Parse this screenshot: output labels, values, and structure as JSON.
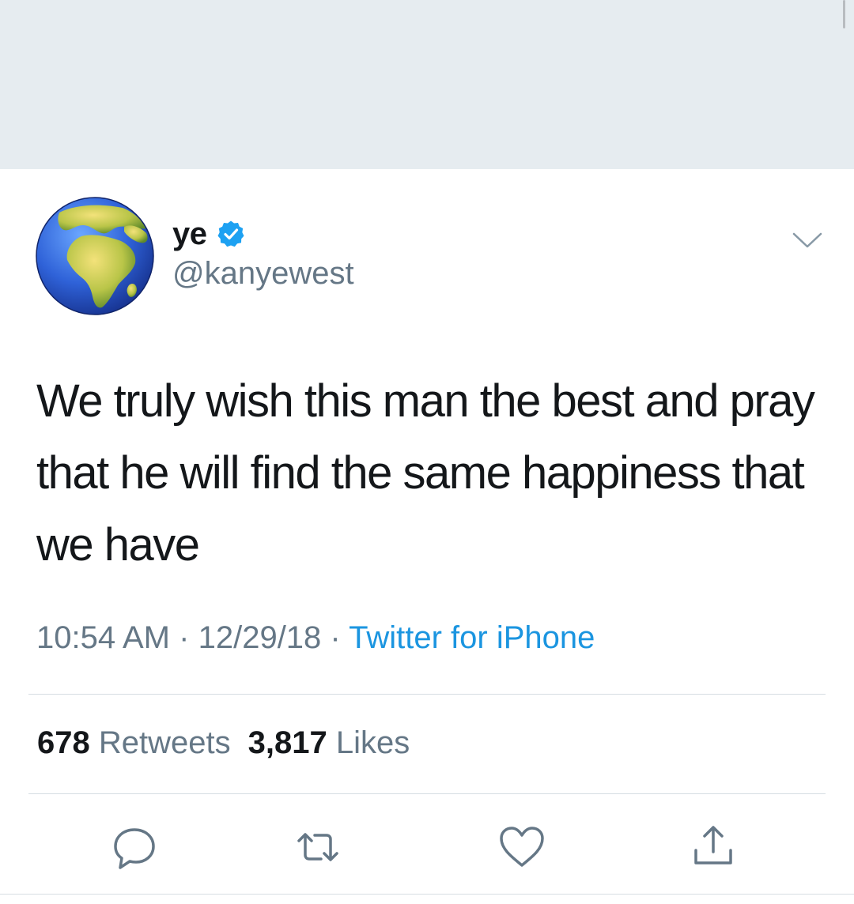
{
  "user": {
    "display_name": "ye",
    "handle": "@kanyewest",
    "avatar_icon": "earth-globe-icon",
    "verified_icon": "verified-badge-icon"
  },
  "tweet": {
    "text": "We truly wish this man the best and pray that he will find the same happiness that we have",
    "time": "10:54 AM",
    "date": "12/29/18",
    "separator": "·",
    "source": "Twitter for iPhone"
  },
  "stats": {
    "retweets_count": "678",
    "retweets_label": "Retweets",
    "likes_count": "3,817",
    "likes_label": "Likes"
  },
  "actions": {
    "reply_icon": "reply-icon",
    "retweet_icon": "retweet-icon",
    "like_icon": "heart-icon",
    "share_icon": "share-icon"
  },
  "colors": {
    "background_band": "#e6ecf0",
    "text_primary": "#14171a",
    "text_secondary": "#657786",
    "link": "#1b95e0",
    "verified": "#1da1f2"
  }
}
